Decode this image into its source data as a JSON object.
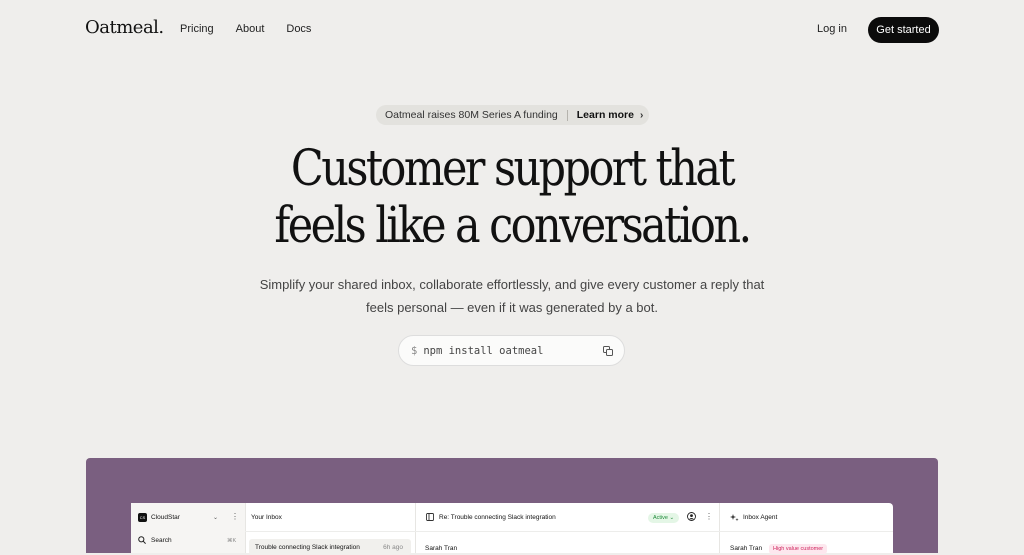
{
  "nav": {
    "logo": "Oatmeal.",
    "links": [
      "Pricing",
      "About",
      "Docs"
    ],
    "login": "Log in",
    "cta": "Get started"
  },
  "announcement": {
    "text": "Oatmeal raises 80M Series A funding",
    "link": "Learn more",
    "icon": "chevron-right-icon"
  },
  "hero": {
    "headline_line1": "Customer support that",
    "headline_line2": "feels like a conversation.",
    "sub_line1": "Simplify your shared inbox, collaborate effortlessly, and give every customer a reply that",
    "sub_line2": "feels personal — even if it was generated by a bot.",
    "npm_prompt": "$",
    "npm_command": "npm install oatmeal",
    "copy_icon": "copy-icon"
  },
  "app_preview": {
    "workspace_badge": "CS",
    "workspace_name": "CloudStar",
    "search_label": "Search",
    "search_shortcut": "⌘K",
    "inbox_title": "Your Inbox",
    "thread_title": "Trouble connecting Slack integration",
    "thread_time": "6h ago",
    "conversation_title": "Re: Trouble connecting Slack integration",
    "status": "Active",
    "sender": "Sarah Tran",
    "agent_title": "Inbox Agent",
    "agent_sender": "Sarah Tran",
    "agent_tag": "High value customer"
  },
  "colors": {
    "background": "#efeeec",
    "cta_bg": "#0b0b0b",
    "hero_frame": "#7a5f80",
    "status_green": "#1f8a3a",
    "tag_pink": "#d0245e"
  }
}
